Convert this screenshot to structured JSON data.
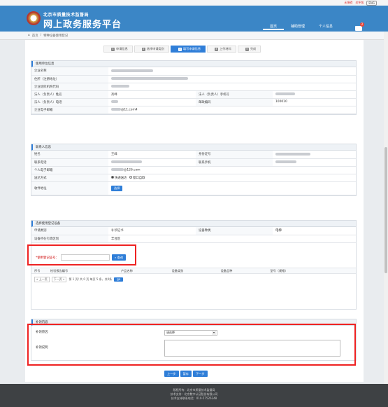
{
  "topbar": {
    "login": "无障碍",
    "register": "关怀版",
    "lang": "ENG"
  },
  "header": {
    "org": "北京市质量技术监督局",
    "title": "网上政务服务平台",
    "nav": [
      "首页",
      "辅助管理",
      "个人信息"
    ],
    "mail_badge": "2"
  },
  "breadcrumb": {
    "home": "首页",
    "sep": "/",
    "current": "特种设备使用登记"
  },
  "steps": [
    {
      "num": "1",
      "label": "申请信息"
    },
    {
      "num": "2",
      "label": "选择申请类别"
    },
    {
      "num": "3",
      "label": "填写申请信息"
    },
    {
      "num": "4",
      "label": "上传材料"
    },
    {
      "num": "5",
      "label": "完成"
    }
  ],
  "unit": {
    "title": "使用单位信息",
    "company_name_label": "企业名称",
    "address_label": "住所（注册地址）",
    "org_code_label": "企业组织机构代码",
    "legal_name_label": "法人（负责人）姓名",
    "legal_name_value": "高峰",
    "legal_mobile_label": "法人（负责人）手机号",
    "legal_phone_label": "法人（负责人）电话",
    "postcode_label": "邮政编码",
    "postcode_value": "100010",
    "email_label": "企业电子邮箱",
    "email_value": "@11.com4"
  },
  "contact": {
    "title": "联系人信息",
    "name_label": "姓名",
    "name_value": "王峰",
    "id_label": "身份证号",
    "phone_label": "联系电话",
    "mobile_label": "联系手机",
    "email_label": "个人电子邮箱",
    "email_value": "@126.com",
    "delivery_label": "送达方式",
    "delivery_opt1": "快递送达",
    "delivery_opt2": "窗口自取",
    "address_label": "收件地址",
    "select_btn": "选择"
  },
  "device": {
    "title": "选择使用登记设备",
    "apply_type_label": "申请类别",
    "apply_type_value": "补领证书",
    "category_label": "设备种类",
    "category_value": "电梯",
    "district_label": "设备所在行政区划",
    "district_value": "丰台区",
    "cert_label": "*使用登记证号：",
    "cert_placeholder": "",
    "search_btn": "查询",
    "cols": [
      "序号",
      "检验报告编号",
      "产品名称",
      "设备类别",
      "设备品种",
      "型号（规格）"
    ],
    "pager": {
      "prev": "« 上一页",
      "next": "下一页 »",
      "text": "第 1 页/ 共 0 页 每页 5 条，共0条",
      "go": "go"
    }
  },
  "reissue": {
    "title": "补领内容",
    "reason_label": "补领原因",
    "reason_value": "请选择",
    "desc_label": "补领说明"
  },
  "actions": {
    "prev": "上一步",
    "save": "暂存",
    "next": "下一步"
  },
  "footer": {
    "line1": "版权所有：北京市质量技术监督局",
    "line2": "技术支持：北京数字认证股份有限公司",
    "line3": "技术支持联系电话：010-57526248"
  }
}
